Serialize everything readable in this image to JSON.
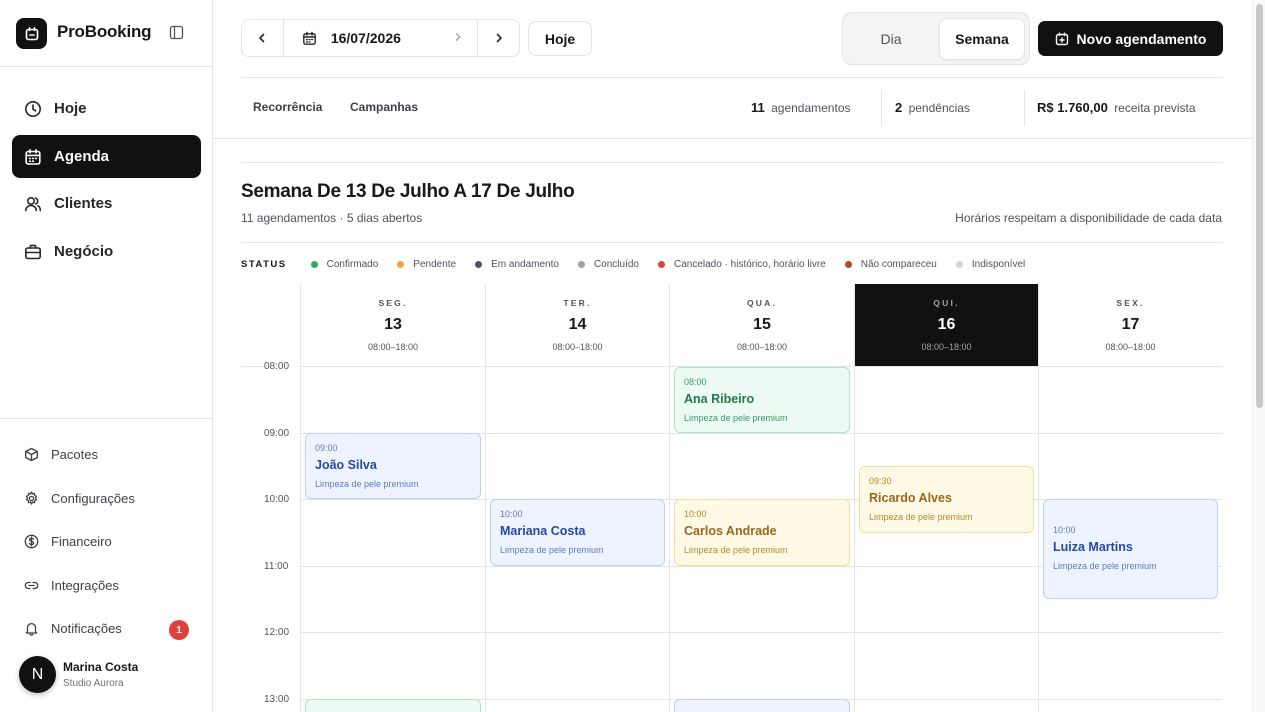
{
  "brand": {
    "name": "ProBooking"
  },
  "nav": [
    {
      "label": "Hoje",
      "icon": "clock-icon"
    },
    {
      "label": "Agenda",
      "icon": "calendar-icon",
      "active": true
    },
    {
      "label": "Clientes",
      "icon": "users-icon"
    },
    {
      "label": "Negócio",
      "icon": "briefcase-icon"
    }
  ],
  "subnav": [
    {
      "label": "Pacotes",
      "icon": "package-icon"
    },
    {
      "label": "Configurações",
      "icon": "gear-icon"
    },
    {
      "label": "Financeiro",
      "icon": "dollar-circle-icon"
    },
    {
      "label": "Integrações",
      "icon": "link-icon"
    },
    {
      "label": "Notificações",
      "icon": "bell-icon",
      "badge": "1"
    }
  ],
  "user": {
    "initial": "N",
    "name": "Marina Costa",
    "studio": "Studio Aurora"
  },
  "toolbar": {
    "date": "16/07/2026",
    "today_label": "Hoje",
    "view_day": "Dia",
    "view_week": "Semana",
    "new_label": "Novo agendamento"
  },
  "tabs": {
    "recurrence": "Recorrência",
    "campaigns": "Campanhas"
  },
  "stats": {
    "appointments_value": "11",
    "appointments_label": "agendamentos",
    "pending_value": "2",
    "pending_label": "pendências",
    "revenue_value": "R$ 1.760,00",
    "revenue_label": "receita prevista"
  },
  "week": {
    "title": "Semana De 13 De Julho A 17 De Julho",
    "subtitle": "11 agendamentos · 5 dias abertos",
    "note": "Horários respeitam a disponibilidade de cada data"
  },
  "legend": {
    "title": "STATUS",
    "items": [
      {
        "label": "Confirmado",
        "color": "#2faa63"
      },
      {
        "label": "Pendente",
        "color": "#f0a13a"
      },
      {
        "label": "Em andamento",
        "color": "#4b5563"
      },
      {
        "label": "Concluído",
        "color": "#9ca3af"
      },
      {
        "label": "Cancelado · histórico, horário livre",
        "color": "#e0413a"
      },
      {
        "label": "Não compareceu",
        "color": "#b54a1f"
      },
      {
        "label": "Indisponível",
        "color": "#d1d5db"
      }
    ]
  },
  "days": [
    {
      "name": "SEG.",
      "date": "13",
      "hours": "08:00–18:00"
    },
    {
      "name": "TER.",
      "date": "14",
      "hours": "08:00–18:00"
    },
    {
      "name": "QUA.",
      "date": "15",
      "hours": "08:00–18:00"
    },
    {
      "name": "QUI.",
      "date": "16",
      "hours": "08:00–18:00",
      "today": true
    },
    {
      "name": "SEX.",
      "date": "17",
      "hours": "08:00–18:00"
    }
  ],
  "times": [
    "08:00",
    "09:00",
    "10:00",
    "11:00",
    "12:00",
    "13:00"
  ],
  "appointments": [
    {
      "time": "09:00",
      "name": "João Silva",
      "service": "Limpeza de pele premium",
      "color": "blue"
    },
    {
      "time": "10:00",
      "name": "Mariana Costa",
      "service": "Limpeza de pele premium",
      "color": "blue"
    },
    {
      "time": "08:00",
      "name": "Ana Ribeiro",
      "service": "Limpeza de pele premium",
      "color": "green"
    },
    {
      "time": "10:00",
      "name": "Carlos Andrade",
      "service": "Limpeza de pele premium",
      "color": "yellow"
    },
    {
      "time": "09:30",
      "name": "Ricardo Alves",
      "service": "Limpeza de pele premium",
      "color": "yellow"
    },
    {
      "time": "10:00",
      "name": "Luiza Martins",
      "service": "Limpeza de pele premium",
      "color": "blue"
    }
  ]
}
